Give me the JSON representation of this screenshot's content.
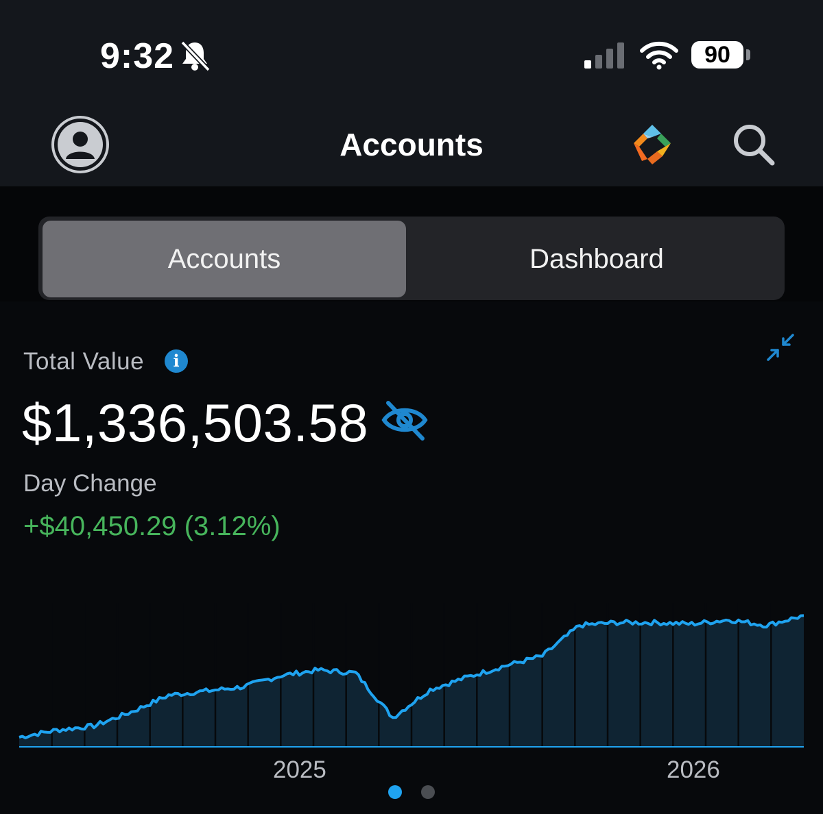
{
  "status_bar": {
    "time": "9:32",
    "battery": "90"
  },
  "nav": {
    "title": "Accounts"
  },
  "segments": [
    {
      "label": "Accounts",
      "selected": true
    },
    {
      "label": "Dashboard",
      "selected": false
    }
  ],
  "summary": {
    "total_label": "Total Value",
    "total_value": "$1,336,503.58",
    "day_change_label": "Day Change",
    "day_change_value": "+$40,450.29 (3.12%)"
  },
  "pager": {
    "count": 2,
    "active_index": 0
  },
  "colors": {
    "accent": "#1fa3f0",
    "positive": "#47b55c",
    "info": "#1f88d0",
    "fill": "#0f2433"
  },
  "icons": [
    "bell-off-icon",
    "signal-icon",
    "wifi-icon",
    "avatar-icon",
    "brand-logo-icon",
    "search-icon",
    "info-icon",
    "collapse-icon",
    "hide-icon"
  ],
  "chart_data": {
    "type": "area",
    "title": "",
    "xlabel": "",
    "ylabel": "",
    "x_ticks": [
      "2025",
      "2026"
    ],
    "grid": false,
    "y_axis_shown": false,
    "note_units": "relative value, y axis unlabeled",
    "x": [
      "2024-06",
      "2024-07",
      "2024-08",
      "2024-09",
      "2024-10",
      "2024-11",
      "2024-12",
      "2025-01",
      "2025-02",
      "2025-03",
      "2025-04",
      "2025-05",
      "2025-06",
      "2025-07",
      "2025-08",
      "2025-09",
      "2025-10",
      "2025-11",
      "2025-12",
      "2026-01",
      "2026-02",
      "2026-03"
    ],
    "series": [
      {
        "values": [
          0.04,
          0.09,
          0.12,
          0.22,
          0.34,
          0.37,
          0.4,
          0.48,
          0.52,
          0.5,
          0.18,
          0.38,
          0.47,
          0.55,
          0.62,
          0.84,
          0.86,
          0.86,
          0.85,
          0.88,
          0.84,
          0.91
        ]
      }
    ]
  }
}
